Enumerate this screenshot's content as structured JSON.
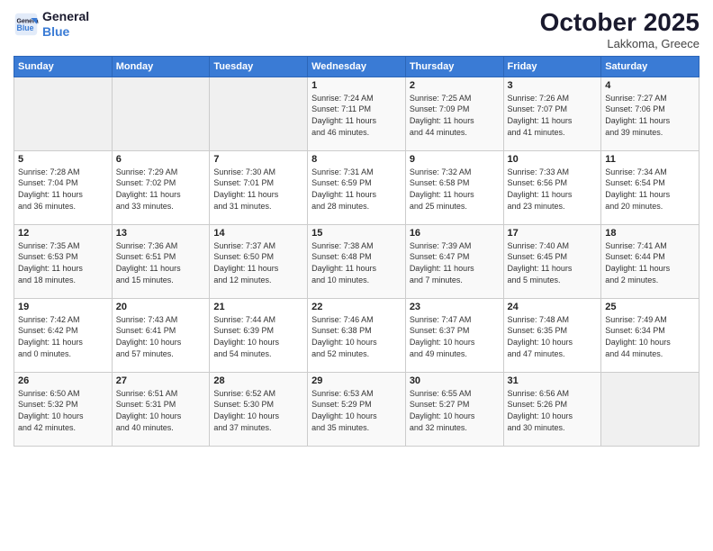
{
  "header": {
    "logo_line1": "General",
    "logo_line2": "Blue",
    "month": "October 2025",
    "location": "Lakkoma, Greece"
  },
  "weekdays": [
    "Sunday",
    "Monday",
    "Tuesday",
    "Wednesday",
    "Thursday",
    "Friday",
    "Saturday"
  ],
  "weeks": [
    [
      {
        "day": "",
        "info": ""
      },
      {
        "day": "",
        "info": ""
      },
      {
        "day": "",
        "info": ""
      },
      {
        "day": "1",
        "info": "Sunrise: 7:24 AM\nSunset: 7:11 PM\nDaylight: 11 hours\nand 46 minutes."
      },
      {
        "day": "2",
        "info": "Sunrise: 7:25 AM\nSunset: 7:09 PM\nDaylight: 11 hours\nand 44 minutes."
      },
      {
        "day": "3",
        "info": "Sunrise: 7:26 AM\nSunset: 7:07 PM\nDaylight: 11 hours\nand 41 minutes."
      },
      {
        "day": "4",
        "info": "Sunrise: 7:27 AM\nSunset: 7:06 PM\nDaylight: 11 hours\nand 39 minutes."
      }
    ],
    [
      {
        "day": "5",
        "info": "Sunrise: 7:28 AM\nSunset: 7:04 PM\nDaylight: 11 hours\nand 36 minutes."
      },
      {
        "day": "6",
        "info": "Sunrise: 7:29 AM\nSunset: 7:02 PM\nDaylight: 11 hours\nand 33 minutes."
      },
      {
        "day": "7",
        "info": "Sunrise: 7:30 AM\nSunset: 7:01 PM\nDaylight: 11 hours\nand 31 minutes."
      },
      {
        "day": "8",
        "info": "Sunrise: 7:31 AM\nSunset: 6:59 PM\nDaylight: 11 hours\nand 28 minutes."
      },
      {
        "day": "9",
        "info": "Sunrise: 7:32 AM\nSunset: 6:58 PM\nDaylight: 11 hours\nand 25 minutes."
      },
      {
        "day": "10",
        "info": "Sunrise: 7:33 AM\nSunset: 6:56 PM\nDaylight: 11 hours\nand 23 minutes."
      },
      {
        "day": "11",
        "info": "Sunrise: 7:34 AM\nSunset: 6:54 PM\nDaylight: 11 hours\nand 20 minutes."
      }
    ],
    [
      {
        "day": "12",
        "info": "Sunrise: 7:35 AM\nSunset: 6:53 PM\nDaylight: 11 hours\nand 18 minutes."
      },
      {
        "day": "13",
        "info": "Sunrise: 7:36 AM\nSunset: 6:51 PM\nDaylight: 11 hours\nand 15 minutes."
      },
      {
        "day": "14",
        "info": "Sunrise: 7:37 AM\nSunset: 6:50 PM\nDaylight: 11 hours\nand 12 minutes."
      },
      {
        "day": "15",
        "info": "Sunrise: 7:38 AM\nSunset: 6:48 PM\nDaylight: 11 hours\nand 10 minutes."
      },
      {
        "day": "16",
        "info": "Sunrise: 7:39 AM\nSunset: 6:47 PM\nDaylight: 11 hours\nand 7 minutes."
      },
      {
        "day": "17",
        "info": "Sunrise: 7:40 AM\nSunset: 6:45 PM\nDaylight: 11 hours\nand 5 minutes."
      },
      {
        "day": "18",
        "info": "Sunrise: 7:41 AM\nSunset: 6:44 PM\nDaylight: 11 hours\nand 2 minutes."
      }
    ],
    [
      {
        "day": "19",
        "info": "Sunrise: 7:42 AM\nSunset: 6:42 PM\nDaylight: 11 hours\nand 0 minutes."
      },
      {
        "day": "20",
        "info": "Sunrise: 7:43 AM\nSunset: 6:41 PM\nDaylight: 10 hours\nand 57 minutes."
      },
      {
        "day": "21",
        "info": "Sunrise: 7:44 AM\nSunset: 6:39 PM\nDaylight: 10 hours\nand 54 minutes."
      },
      {
        "day": "22",
        "info": "Sunrise: 7:46 AM\nSunset: 6:38 PM\nDaylight: 10 hours\nand 52 minutes."
      },
      {
        "day": "23",
        "info": "Sunrise: 7:47 AM\nSunset: 6:37 PM\nDaylight: 10 hours\nand 49 minutes."
      },
      {
        "day": "24",
        "info": "Sunrise: 7:48 AM\nSunset: 6:35 PM\nDaylight: 10 hours\nand 47 minutes."
      },
      {
        "day": "25",
        "info": "Sunrise: 7:49 AM\nSunset: 6:34 PM\nDaylight: 10 hours\nand 44 minutes."
      }
    ],
    [
      {
        "day": "26",
        "info": "Sunrise: 6:50 AM\nSunset: 5:32 PM\nDaylight: 10 hours\nand 42 minutes."
      },
      {
        "day": "27",
        "info": "Sunrise: 6:51 AM\nSunset: 5:31 PM\nDaylight: 10 hours\nand 40 minutes."
      },
      {
        "day": "28",
        "info": "Sunrise: 6:52 AM\nSunset: 5:30 PM\nDaylight: 10 hours\nand 37 minutes."
      },
      {
        "day": "29",
        "info": "Sunrise: 6:53 AM\nSunset: 5:29 PM\nDaylight: 10 hours\nand 35 minutes."
      },
      {
        "day": "30",
        "info": "Sunrise: 6:55 AM\nSunset: 5:27 PM\nDaylight: 10 hours\nand 32 minutes."
      },
      {
        "day": "31",
        "info": "Sunrise: 6:56 AM\nSunset: 5:26 PM\nDaylight: 10 hours\nand 30 minutes."
      },
      {
        "day": "",
        "info": ""
      }
    ]
  ]
}
